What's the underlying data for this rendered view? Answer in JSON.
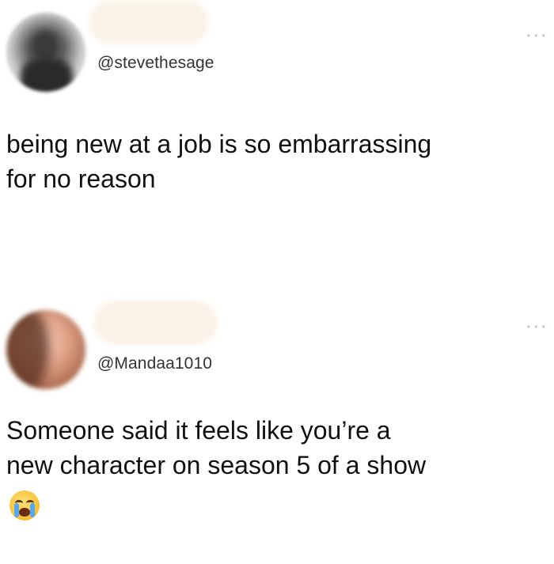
{
  "tweets": [
    {
      "handle": "@stevethesage",
      "text": "being new at a job is so embarrassing\nfor no reason",
      "more_icon": "more-dots-icon",
      "avatar": "blurred-profile-photo"
    },
    {
      "handle": "@Mandaa1010",
      "text": "Someone said it feels like you’re a\nnew character on season 5 of a show",
      "emoji": "loudly-crying-face-icon",
      "more_icon": "more-dots-icon",
      "avatar": "blurred-profile-photo"
    }
  ]
}
